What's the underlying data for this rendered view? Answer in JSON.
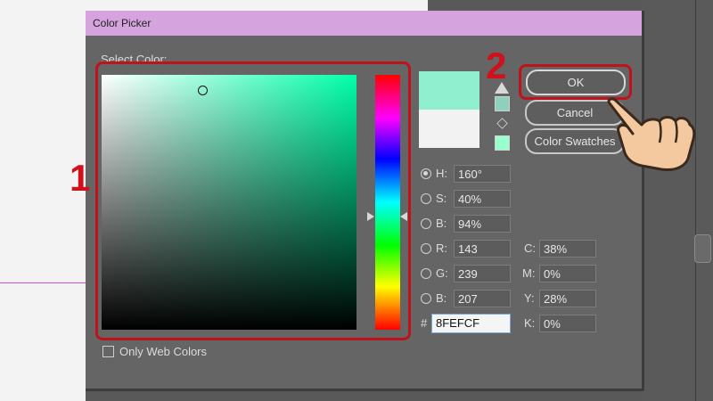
{
  "dialog": {
    "title": "Color Picker",
    "select_color_label": "Select Color:"
  },
  "buttons": {
    "ok": "OK",
    "cancel": "Cancel",
    "swatches": "Color Swatches"
  },
  "hsb": [
    {
      "label": "H:",
      "value": "160°",
      "selected": true
    },
    {
      "label": "S:",
      "value": "40%",
      "selected": false
    },
    {
      "label": "B:",
      "value": "94%",
      "selected": false
    }
  ],
  "rgb": [
    {
      "label": "R:",
      "value": "143"
    },
    {
      "label": "G:",
      "value": "239"
    },
    {
      "label": "B:",
      "value": "207"
    }
  ],
  "cmyk": [
    {
      "label": "C:",
      "value": "38%"
    },
    {
      "label": "M:",
      "value": "0%"
    },
    {
      "label": "Y:",
      "value": "28%"
    },
    {
      "label": "K:",
      "value": "0%"
    }
  ],
  "hex": {
    "label": "#",
    "value": "8FEFCF"
  },
  "only_web_colors": "Only Web Colors",
  "annotations": {
    "step1": "1",
    "step2": "2"
  },
  "colors": {
    "new_color": "#8FEFCF",
    "old_color": "#F2F2F2",
    "hue_base": "#00FFAA",
    "highlight": "#C0121B"
  }
}
